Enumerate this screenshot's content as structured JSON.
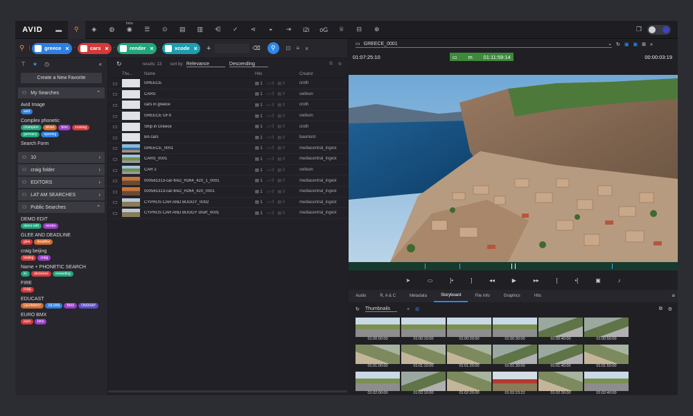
{
  "app": {
    "logo": "AVID"
  },
  "toolbar": {
    "icons": [
      "folder-icon",
      "search-icon",
      "diamond-icon",
      "globe-icon",
      "chat-icon",
      "list-icon",
      "magnify-globe-icon",
      "grid-icon",
      "film-icon",
      "share-icon",
      "check-icon",
      "share2-icon",
      "eye-icon",
      "rows-icon",
      "i2i-icon",
      "og-icon",
      "trophy-icon",
      "monitor-icon",
      "zoom-icon"
    ],
    "text_icons": {
      "i2i": "i2i",
      "og": "oG"
    },
    "beta_label": "beta"
  },
  "search": {
    "chips": [
      {
        "label": "greece",
        "color": "#2e7fe0"
      },
      {
        "label": "cars",
        "color": "#d43a3a"
      },
      {
        "label": "render",
        "color": "#21a77a"
      },
      {
        "label": "xcode",
        "color": "#1f9db0"
      }
    ],
    "seps": [
      "|",
      "-",
      "-",
      "-"
    ]
  },
  "sidebar": {
    "create_button": "Create a New Favorite",
    "my_searches": "My Searches",
    "favorites": [
      {
        "title": "Avid Image",
        "tags": [
          {
            "t": "avid",
            "c": "#2e7fe0"
          }
        ]
      },
      {
        "title": "Complex phonetic",
        "tags": [
          {
            "t": "champion",
            "c": "#1fa37a"
          },
          {
            "t": "silvan",
            "c": "#d46a2e"
          },
          {
            "t": "bmx",
            "c": "#9a3ec9"
          },
          {
            "t": "cruising",
            "c": "#d43a3a"
          },
          {
            "t": "germany",
            "c": "#1fa37a"
          },
          {
            "t": "opening",
            "c": "#2e7fe0"
          }
        ]
      },
      {
        "title": "Search Form",
        "tags": []
      }
    ],
    "folders": [
      {
        "label": "10",
        "icon": "people-icon"
      },
      {
        "label": "craig folder",
        "icon": "people-icon"
      },
      {
        "label": "EDITORS",
        "icon": "people-icon"
      },
      {
        "label": "LAT AM SEARCHES",
        "icon": "people-icon"
      }
    ],
    "public_searches": "Public Searches",
    "public": [
      {
        "title": "DEMO EDIT",
        "tags": [
          {
            "t": "demo edit",
            "c": "#1fa37a"
          },
          {
            "t": "render",
            "c": "#9a3ec9"
          }
        ]
      },
      {
        "title": "GLEE AND DEADLINE",
        "tags": [
          {
            "t": "glee",
            "c": "#d43a3a"
          },
          {
            "t": "deadline",
            "c": "#d46a2e"
          }
        ]
      },
      {
        "title": "craig beijing",
        "tags": [
          {
            "t": "beijing",
            "c": "#d43a3a"
          },
          {
            "t": "craig",
            "c": "#9a3ec9"
          }
        ]
      },
      {
        "title": "Name + PHONETIC SEARCH",
        "tags": [
          {
            "t": "itv",
            "c": "#1fa37a"
          },
          {
            "t": "decisions",
            "c": "#d43a3a"
          },
          {
            "t": "rewarding",
            "c": "#1fa37a"
          }
        ]
      },
      {
        "title": "FIRE",
        "tags": [
          {
            "t": "FIRE",
            "c": "#d43a3a"
          }
        ]
      },
      {
        "title": "EDUCAST",
        "tags": [
          {
            "t": "GERMANY",
            "c": "#d46a2e"
          },
          {
            "t": "SILVAN",
            "c": "#2e7fe0"
          },
          {
            "t": "BMX",
            "c": "#9a3ec9"
          },
          {
            "t": "ONDRAY",
            "c": "#5a4ec9"
          }
        ]
      },
      {
        "title": "EURO BMX",
        "tags": [
          {
            "t": "euro",
            "c": "#d43a3a"
          },
          {
            "t": "bmx",
            "c": "#9a3ec9"
          }
        ]
      }
    ]
  },
  "results": {
    "count_label": "results: 13",
    "sort_label": "sort by:",
    "sort_value": "Relevance",
    "order_value": "Descending",
    "columns": [
      "Thu...",
      "Name",
      "Hits",
      "Creator"
    ],
    "rows": [
      {
        "name": "GREECE",
        "hits": "1",
        "zero1": "0",
        "zero2": "0",
        "creator": "croth",
        "thumb": "avid"
      },
      {
        "name": "CARS",
        "hits": "1",
        "zero1": "0",
        "zero2": "0",
        "creator": "cwilson",
        "thumb": "avid"
      },
      {
        "name": "cars in greece",
        "hits": "1",
        "zero1": "0",
        "zero2": "0",
        "creator": "croth",
        "thumb": "avid"
      },
      {
        "name": "GREECE GFX",
        "hits": "1",
        "zero1": "0",
        "zero2": "0",
        "creator": "cwilson",
        "thumb": "avid"
      },
      {
        "name": "Ship in Greece",
        "hits": "1",
        "zero1": "0",
        "zero2": "0",
        "creator": "croth",
        "thumb": "avid"
      },
      {
        "name": "BA cars",
        "hits": "1",
        "zero1": "0",
        "zero2": "0",
        "creator": "baumont",
        "thumb": "avid"
      },
      {
        "name": "GREECE_0001",
        "hits": "1",
        "zero1": "0",
        "zero2": "0",
        "creator": "mediacentral_ingest",
        "thumb": "sea"
      },
      {
        "name": "CARS_0001",
        "hits": "1",
        "zero1": "0",
        "zero2": "0",
        "creator": "mediacentral_ingest",
        "thumb": "road"
      },
      {
        "name": "CAR 2",
        "hits": "1",
        "zero1": "0",
        "zero2": "0",
        "creator": "cwilson",
        "thumb": "road"
      },
      {
        "name": "000561313-car-fire2_H264_420_1_0001",
        "hits": "1",
        "zero1": "0",
        "zero2": "0",
        "creator": "mediacentral_ingest",
        "thumb": "fire"
      },
      {
        "name": "000561313-car-fire2_H264_420_0001",
        "hits": "1",
        "zero1": "0",
        "zero2": "0",
        "creator": "mediacentral_ingest",
        "thumb": "fire"
      },
      {
        "name": "CYPRUS CAR AND BUGGY_0002",
        "hits": "1",
        "zero1": "0",
        "zero2": "0",
        "creator": "mediacentral_ingest",
        "thumb": "buggy"
      },
      {
        "name": "CYPRUS CAR AND BUGGY short_0001",
        "hits": "1",
        "zero1": "0",
        "zero2": "0",
        "creator": "mediacentral_ingest",
        "thumb": "buggy"
      }
    ]
  },
  "player": {
    "asset_name": "GREECE_0001",
    "tc_in": "01:07:25:10",
    "tc_mode": "m",
    "tc_current": "01:11:59:14",
    "tc_out": "00:00:03:19"
  },
  "tabs": [
    "Audio",
    "R, A & C",
    "Metadata",
    "Storyboard",
    "File Info",
    "Graphics",
    "Hits"
  ],
  "active_tab": "Storyboard",
  "storyboard": {
    "view": "Thumbnails",
    "thumbs": [
      {
        "tc": "01:00:00:00",
        "k": "track"
      },
      {
        "tc": "01:00:10:00",
        "k": "track"
      },
      {
        "tc": "01:00:20:00",
        "k": "track"
      },
      {
        "tc": "01:00:30:00",
        "k": "track"
      },
      {
        "tc": "01:00:40:00",
        "k": "track2"
      },
      {
        "tc": "01:00:50:00",
        "k": "track2"
      },
      {
        "tc": "01:01:00:00",
        "k": "track3"
      },
      {
        "tc": "01:01:10:00",
        "k": "track3"
      },
      {
        "tc": "01:01:20:00",
        "k": "track3"
      },
      {
        "tc": "01:01:30:00",
        "k": "track2"
      },
      {
        "tc": "01:01:40:00",
        "k": "track2"
      },
      {
        "tc": "01:01:50:00",
        "k": "track3"
      },
      {
        "tc": "01:02:00:00",
        "k": "track"
      },
      {
        "tc": "01:02:10:00",
        "k": "track2"
      },
      {
        "tc": "01:02:20:00",
        "k": "track3"
      },
      {
        "tc": "01:02:23:22",
        "k": "track4"
      },
      {
        "tc": "01:02:30:00",
        "k": "track3"
      },
      {
        "tc": "01:02:40:00",
        "k": "track"
      }
    ]
  },
  "colors": {
    "accent": "#2e87e8",
    "active_tool": "#f08c3a",
    "tc_green": "#3c8a3a"
  }
}
